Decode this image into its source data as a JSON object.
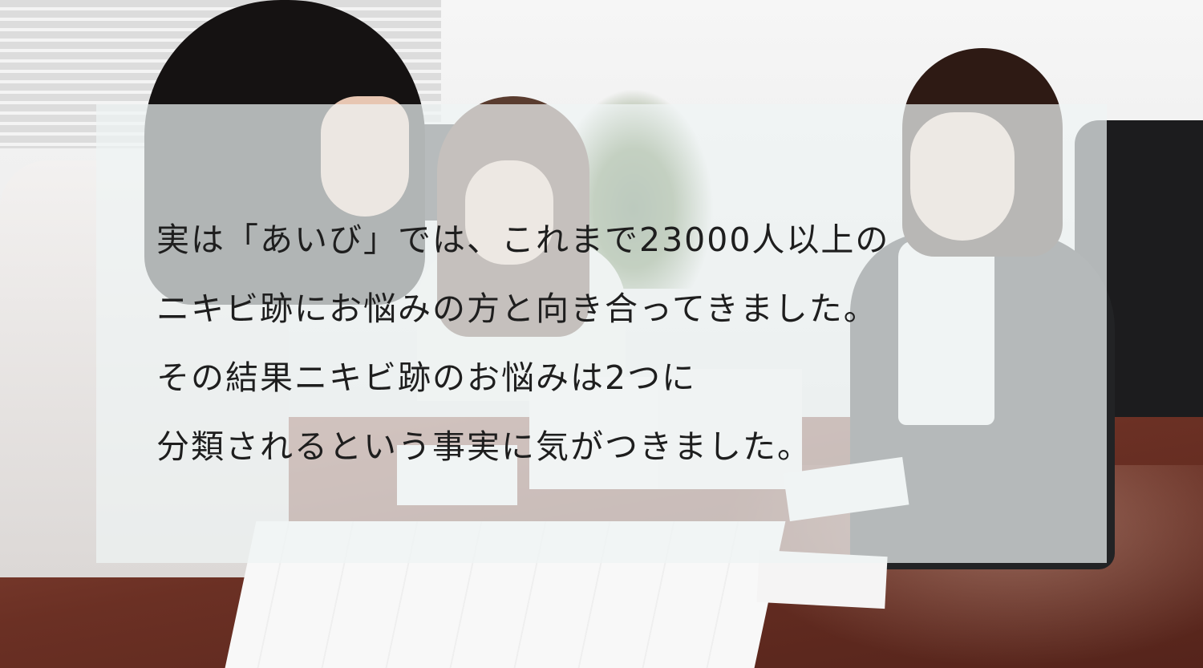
{
  "photo": {
    "subject": "three-women-reviewing-questionnaire-sheets",
    "colors": {
      "panel_overlay": "#eef4f4",
      "text": "#1e1e1e",
      "table": "#6b3024"
    }
  },
  "message": {
    "lines": [
      "実は「あいび」では、これまで23000人以上の",
      "ニキビ跡にお悩みの方と向き合ってきました。",
      "その結果ニキビ跡のお悩みは2つに",
      "分類されるという事実に気がつきました。"
    ]
  }
}
